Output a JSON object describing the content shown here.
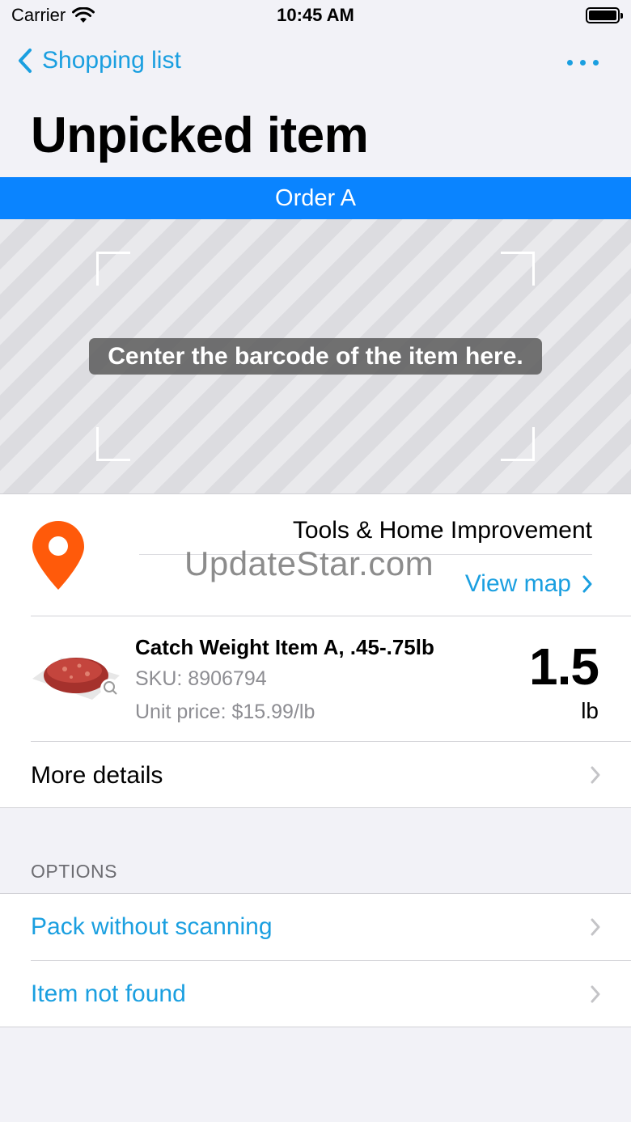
{
  "status": {
    "carrier": "Carrier",
    "time": "10:45 AM"
  },
  "nav": {
    "back_label": "Shopping list",
    "title": "Unpicked item"
  },
  "order": {
    "label": "Order A"
  },
  "scanner": {
    "hint": "Center the barcode of the item here."
  },
  "location": {
    "department": "Tools & Home Improvement",
    "view_map": "View map",
    "watermark": "UpdateStar.com"
  },
  "item": {
    "name": "Catch Weight Item A, .45-.75lb",
    "sku": "SKU: 8906794",
    "unit_price": "Unit price: $15.99/lb",
    "quantity": "1.5",
    "unit": "lb"
  },
  "more_details": {
    "label": "More details"
  },
  "options": {
    "header": "OPTIONS",
    "items": [
      {
        "label": "Pack without scanning"
      },
      {
        "label": "Item not found"
      }
    ]
  },
  "colors": {
    "accent": "#1a9fe0",
    "banner": "#0a84ff",
    "pin": "#ff5a0a"
  }
}
